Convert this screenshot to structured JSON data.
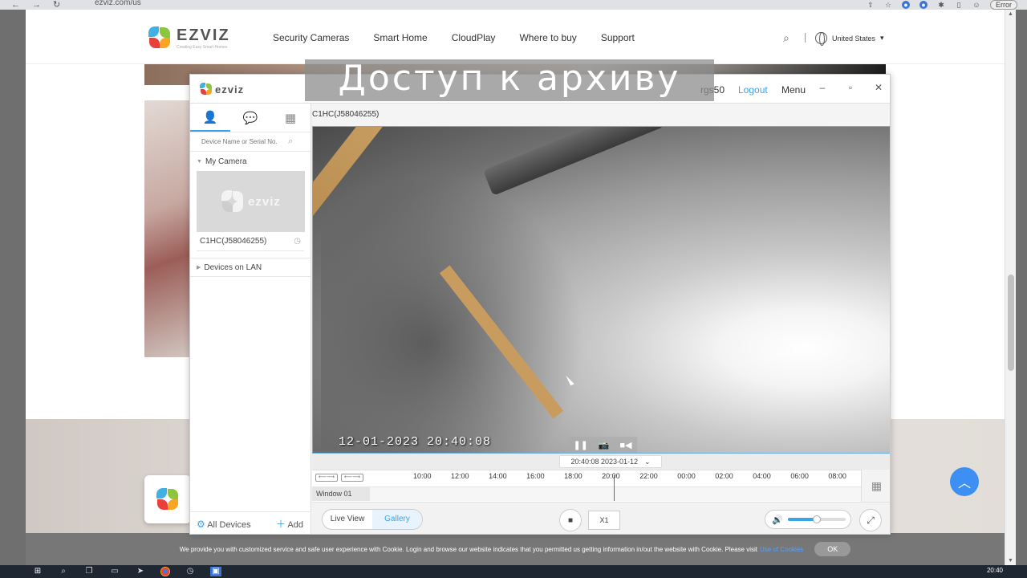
{
  "browser": {
    "url": "ezviz.com/us",
    "error_badge": "Error"
  },
  "site": {
    "logo_text": "EZVIZ",
    "logo_tagline": "Creating Easy Smart Homes",
    "nav": [
      "Security Cameras",
      "Smart Home",
      "CloudPlay",
      "Where to buy",
      "Support"
    ],
    "region": "United States"
  },
  "caption": "Доступ к архиву",
  "app": {
    "logo_text": "ezviz",
    "user": "rgs50",
    "logout": "Logout",
    "menu": "Menu",
    "search_placeholder": "Device Name or Serial No.",
    "group_my_camera": "My Camera",
    "camera_name": "C1HC(J58046255)",
    "thumb_watermark": "ezviz",
    "group_lan": "Devices on LAN",
    "all_devices": "All Devices",
    "add": "Add",
    "video_label": "C1HC(J58046255)",
    "video_timestamp": "12-01-2023 20:40:08",
    "timeline_time": "20:40:08 2023-01-12",
    "ticks": [
      "10:00",
      "12:00",
      "14:00",
      "16:00",
      "18:00",
      "20:00",
      "22:00",
      "00:00",
      "02:00",
      "04:00",
      "06:00",
      "08:00"
    ],
    "track_label": "Window 01",
    "live_view": "Live View",
    "gallery": "Gallery",
    "speed": "Х1",
    "volume_level": 0.5
  },
  "cookie": {
    "text": "We provide you with customized service and safe user experience with Cookie. Login and browse our website indicates that you permitted us getting information in/out the website with Cookie. Please visit",
    "link": "Use of Cookies",
    "ok": "OK"
  },
  "taskbar": {
    "time": "20:40"
  },
  "colors": {
    "accent": "#3ba3e8",
    "scroll_top": "#3e8ff3",
    "playhead": "#e23b3b"
  }
}
